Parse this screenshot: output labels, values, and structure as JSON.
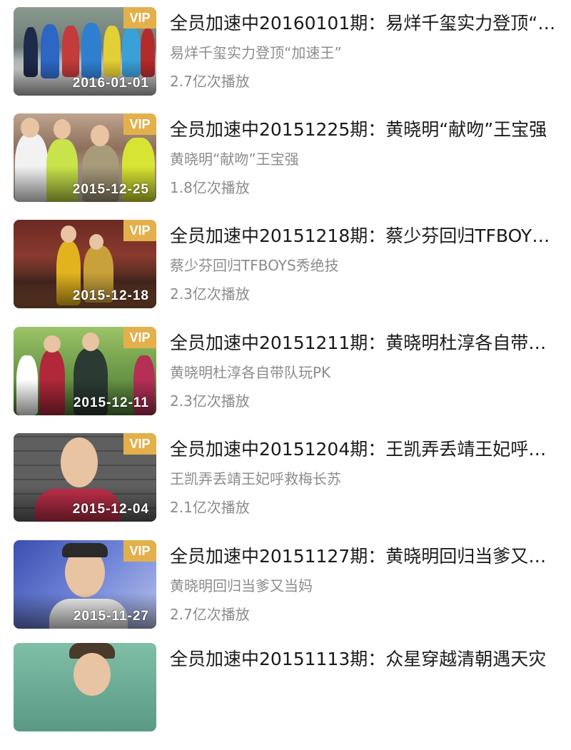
{
  "videos": [
    {
      "title": "全员加速中20160101期：易烊千玺实力登顶“加速王”",
      "subtitle": "易烊千玺实力登顶“加速王”",
      "plays": "2.7亿次播放",
      "date": "2016-01-01",
      "badge": "VIP"
    },
    {
      "title": "全员加速中20151225期：黄晓明“献吻”王宝强",
      "subtitle": "黄晓明“献吻”王宝强",
      "plays": "1.8亿次播放",
      "date": "2015-12-25",
      "badge": "VIP"
    },
    {
      "title": "全员加速中20151218期：蔡少芬回归TFBOYS秀绝技",
      "subtitle": "蔡少芬回归TFBOYS秀绝技",
      "plays": "2.3亿次播放",
      "date": "2015-12-18",
      "badge": "VIP"
    },
    {
      "title": "全员加速中20151211期：黄晓明杜淳各自带队玩PK",
      "subtitle": "黄晓明杜淳各自带队玩PK",
      "plays": "2.3亿次播放",
      "date": "2015-12-11",
      "badge": "VIP"
    },
    {
      "title": "全员加速中20151204期：王凯弄丢靖王妃呼救梅长苏",
      "subtitle": "王凯弄丢靖王妃呼救梅长苏",
      "plays": "2.1亿次播放",
      "date": "2015-12-04",
      "badge": "VIP"
    },
    {
      "title": "全员加速中20151127期：黄晓明回归当爹又当妈",
      "subtitle": "黄晓明回归当爹又当妈",
      "plays": "2.7亿次播放",
      "date": "2015-11-27",
      "badge": "VIP"
    },
    {
      "title": "全员加速中20151113期：众星穿越清朝遇天灾",
      "subtitle": "",
      "plays": "",
      "date": "",
      "badge": ""
    }
  ]
}
